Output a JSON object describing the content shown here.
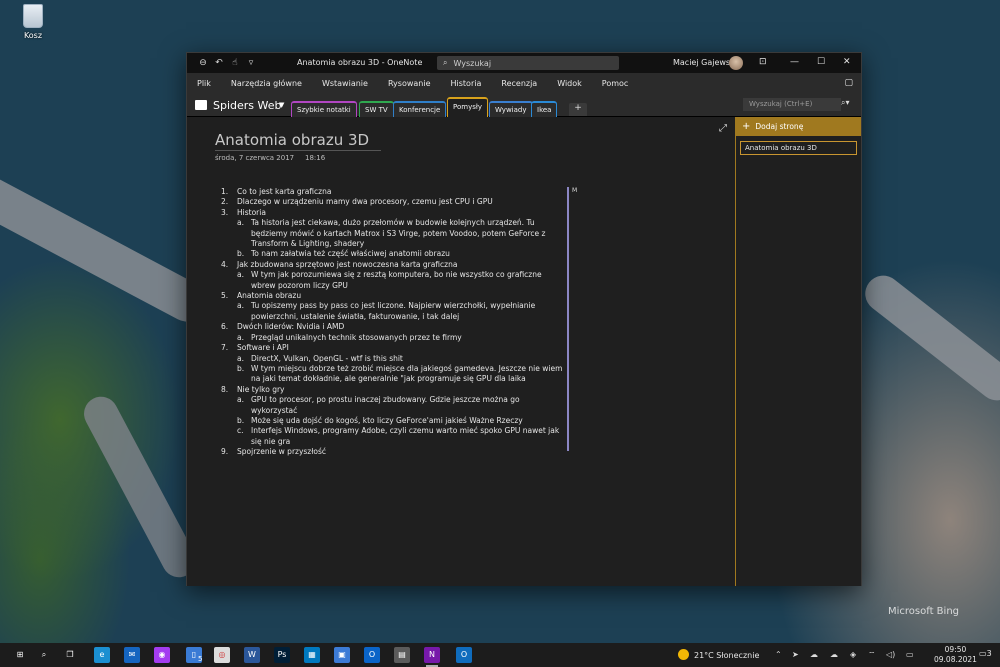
{
  "desktop": {
    "recycle_bin_label": "Kosz",
    "bing_mark": "Microsoft Bing"
  },
  "titlebar": {
    "title": "Anatomia obrazu 3D  -  OneNote",
    "search_label": "Wyszukaj",
    "user_name": "Maciej Gajewski"
  },
  "menu": {
    "items": [
      "Plik",
      "Narzędzia główne",
      "Wstawianie",
      "Rysowanie",
      "Historia",
      "Recenzja",
      "Widok",
      "Pomoc"
    ]
  },
  "notebook": {
    "name": "Spiders Web",
    "sections": [
      {
        "label": "Szybkie notatki",
        "color": "#b146c2"
      },
      {
        "label": "SW TV",
        "color": "#2fa84f"
      },
      {
        "label": "Konferencje",
        "color": "#2f7fc9"
      },
      {
        "label": "Pomysły",
        "color": "#d8a21c",
        "active": true
      },
      {
        "label": "Wywiady",
        "color": "#3a7fd0"
      },
      {
        "label": "Ikea",
        "color": "#2a8ad6"
      }
    ],
    "add_section": "+",
    "page_search_placeholder": "Wyszukaj (Ctrl+E)"
  },
  "page": {
    "title": "Anatomia obrazu 3D",
    "date": "środa, 7 czerwca 2017",
    "time": "18:16",
    "outline_marker": "M",
    "outline": [
      {
        "num": "1.",
        "text": "Co to jest karta graficzna"
      },
      {
        "num": "2.",
        "text": "Dlaczego w urządzeniu mamy dwa procesory, czemu jest CPU i GPU"
      },
      {
        "num": "3.",
        "text": "Historia",
        "sub": [
          {
            "num": "a.",
            "text": "Ta historia jest ciekawa, dużo przełomów w budowie kolejnych urządzeń. Tu będziemy mówić o kartach Matrox i S3 Virge, potem Voodoo, potem GeForce z Transform & Lighting, shadery"
          },
          {
            "num": "b.",
            "text": "To nam załatwia też część właściwej anatomii obrazu"
          }
        ]
      },
      {
        "num": "4.",
        "text": "Jak zbudowana sprzętowo jest nowoczesna karta graficzna",
        "sub": [
          {
            "num": "a.",
            "text": "W tym jak porozumiewa się z resztą komputera, bo nie wszystko co graficzne wbrew pozorom liczy GPU"
          }
        ]
      },
      {
        "num": "5.",
        "text": "Anatomia obrazu",
        "sub": [
          {
            "num": "a.",
            "text": "Tu opiszemy pass by pass co jest liczone. Najpierw wierzchołki, wypełnianie powierzchni, ustalenie światła, fakturowanie, i tak dalej"
          }
        ]
      },
      {
        "num": "6.",
        "text": "Dwóch liderów: Nvidia i AMD",
        "sub": [
          {
            "num": "a.",
            "text": "Przegląd unikalnych technik stosowanych przez te firmy"
          }
        ]
      },
      {
        "num": "7.",
        "text": "Software i API",
        "sub": [
          {
            "num": "a.",
            "text": "DirectX, Vulkan, OpenGL - wtf is this shit"
          },
          {
            "num": "b.",
            "text": "W tym miejscu dobrze też zrobić miejsce dla jakiegoś gamedeva. Jeszcze nie wiem na jaki temat dokładnie, ale generalnie \"jak programuje się GPU dla laika"
          }
        ]
      },
      {
        "num": "8.",
        "text": "Nie tylko gry",
        "sub": [
          {
            "num": "a.",
            "text": "GPU to procesor, po prostu inaczej zbudowany. Gdzie jeszcze można go wykorzystać"
          },
          {
            "num": "b.",
            "text": "Może się uda dojść do kogoś, kto liczy GeForce'ami jakieś Ważne Rzeczy"
          },
          {
            "num": "c.",
            "text": "Interfejs Windows, programy Adobe, czyli czemu warto mieć spoko GPU nawet jak się nie gra"
          }
        ]
      },
      {
        "num": "9.",
        "text": "Spojrzenie w przyszłość"
      }
    ]
  },
  "pagelist": {
    "add_page_label": "Dodaj stronę",
    "pages": [
      "Anatomia obrazu 3D"
    ]
  },
  "taskbar": {
    "apps": [
      {
        "name": "start",
        "glyph": "⊞",
        "color": "#1c1c1c"
      },
      {
        "name": "search",
        "glyph": "⌕",
        "color": "#1c1c1c"
      },
      {
        "name": "task-view",
        "glyph": "❐",
        "color": "#1c1c1c"
      },
      {
        "name": "edge",
        "glyph": "e",
        "color": "#1b8fd1"
      },
      {
        "name": "mail",
        "glyph": "✉",
        "color": "#1565c0"
      },
      {
        "name": "messenger",
        "glyph": "◉",
        "color": "#a43cf0"
      },
      {
        "name": "phone",
        "glyph": "▯",
        "color": "#3a7bd5"
      },
      {
        "name": "chrome",
        "glyph": "◎",
        "color": "#dcdcdc"
      },
      {
        "name": "word",
        "glyph": "W",
        "color": "#2b579a"
      },
      {
        "name": "photoshop",
        "glyph": "Ps",
        "color": "#001e36"
      },
      {
        "name": "trello",
        "glyph": "▦",
        "color": "#0079bf"
      },
      {
        "name": "photos",
        "glyph": "▣",
        "color": "#3c7bd6"
      },
      {
        "name": "outlook-alt",
        "glyph": "O",
        "color": "#0a64c8"
      },
      {
        "name": "calculator",
        "glyph": "▤",
        "color": "#5b5b5b"
      },
      {
        "name": "onenote",
        "glyph": "N",
        "color": "#7719aa"
      },
      {
        "name": "outlook",
        "glyph": "O",
        "color": "#0f6cbd"
      }
    ],
    "phone_badge": "5",
    "weather": "21°C  Słonecznie",
    "time": "09:50",
    "date": "09.08.2021",
    "notification_count": "3"
  }
}
